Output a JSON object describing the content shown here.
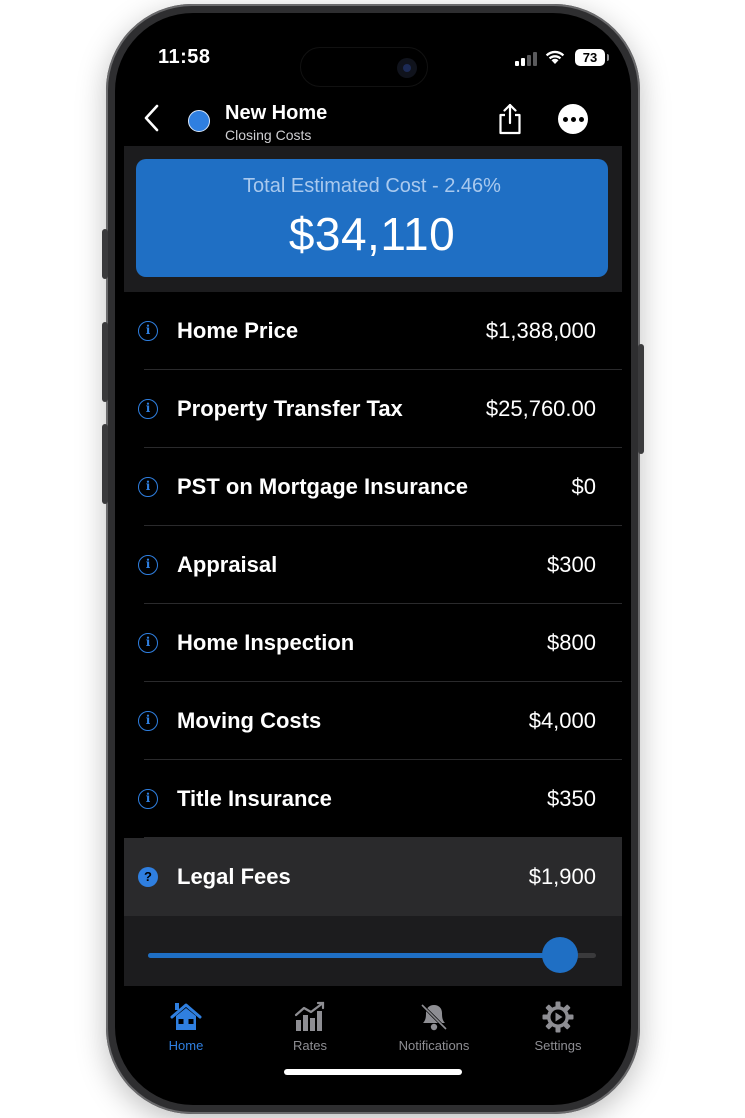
{
  "status": {
    "time": "11:58",
    "battery": "73"
  },
  "nav": {
    "title": "New Home",
    "subtitle": "Closing Costs"
  },
  "summary": {
    "label": "Total Estimated Cost - 2.46%",
    "value": "$34,110"
  },
  "rows": [
    {
      "label": "Home Price",
      "value": "$1,388,000",
      "icon": "info-icon"
    },
    {
      "label": "Property Transfer Tax",
      "value": "$25,760.00",
      "icon": "info-icon"
    },
    {
      "label": "PST on Mortgage Insurance",
      "value": "$0",
      "icon": "info-icon"
    },
    {
      "label": "Appraisal",
      "value": "$300",
      "icon": "info-icon"
    },
    {
      "label": "Home Inspection",
      "value": "$800",
      "icon": "info-icon"
    },
    {
      "label": "Moving Costs",
      "value": "$4,000",
      "icon": "info-icon"
    },
    {
      "label": "Title Insurance",
      "value": "$350",
      "icon": "info-icon"
    },
    {
      "label": "Legal Fees",
      "value": "$1,900",
      "icon": "help-icon"
    }
  ],
  "slider": {
    "fraction": 0.92
  },
  "tabs": [
    {
      "label": "Home",
      "icon": "home-icon",
      "active": true
    },
    {
      "label": "Rates",
      "icon": "chart-icon",
      "active": false
    },
    {
      "label": "Notifications",
      "icon": "bell-icon",
      "active": false
    },
    {
      "label": "Settings",
      "icon": "gear-icon",
      "active": false
    }
  ],
  "colors": {
    "accent": "#1f6fc4",
    "background": "#000000",
    "card": "#1c1c1e"
  }
}
